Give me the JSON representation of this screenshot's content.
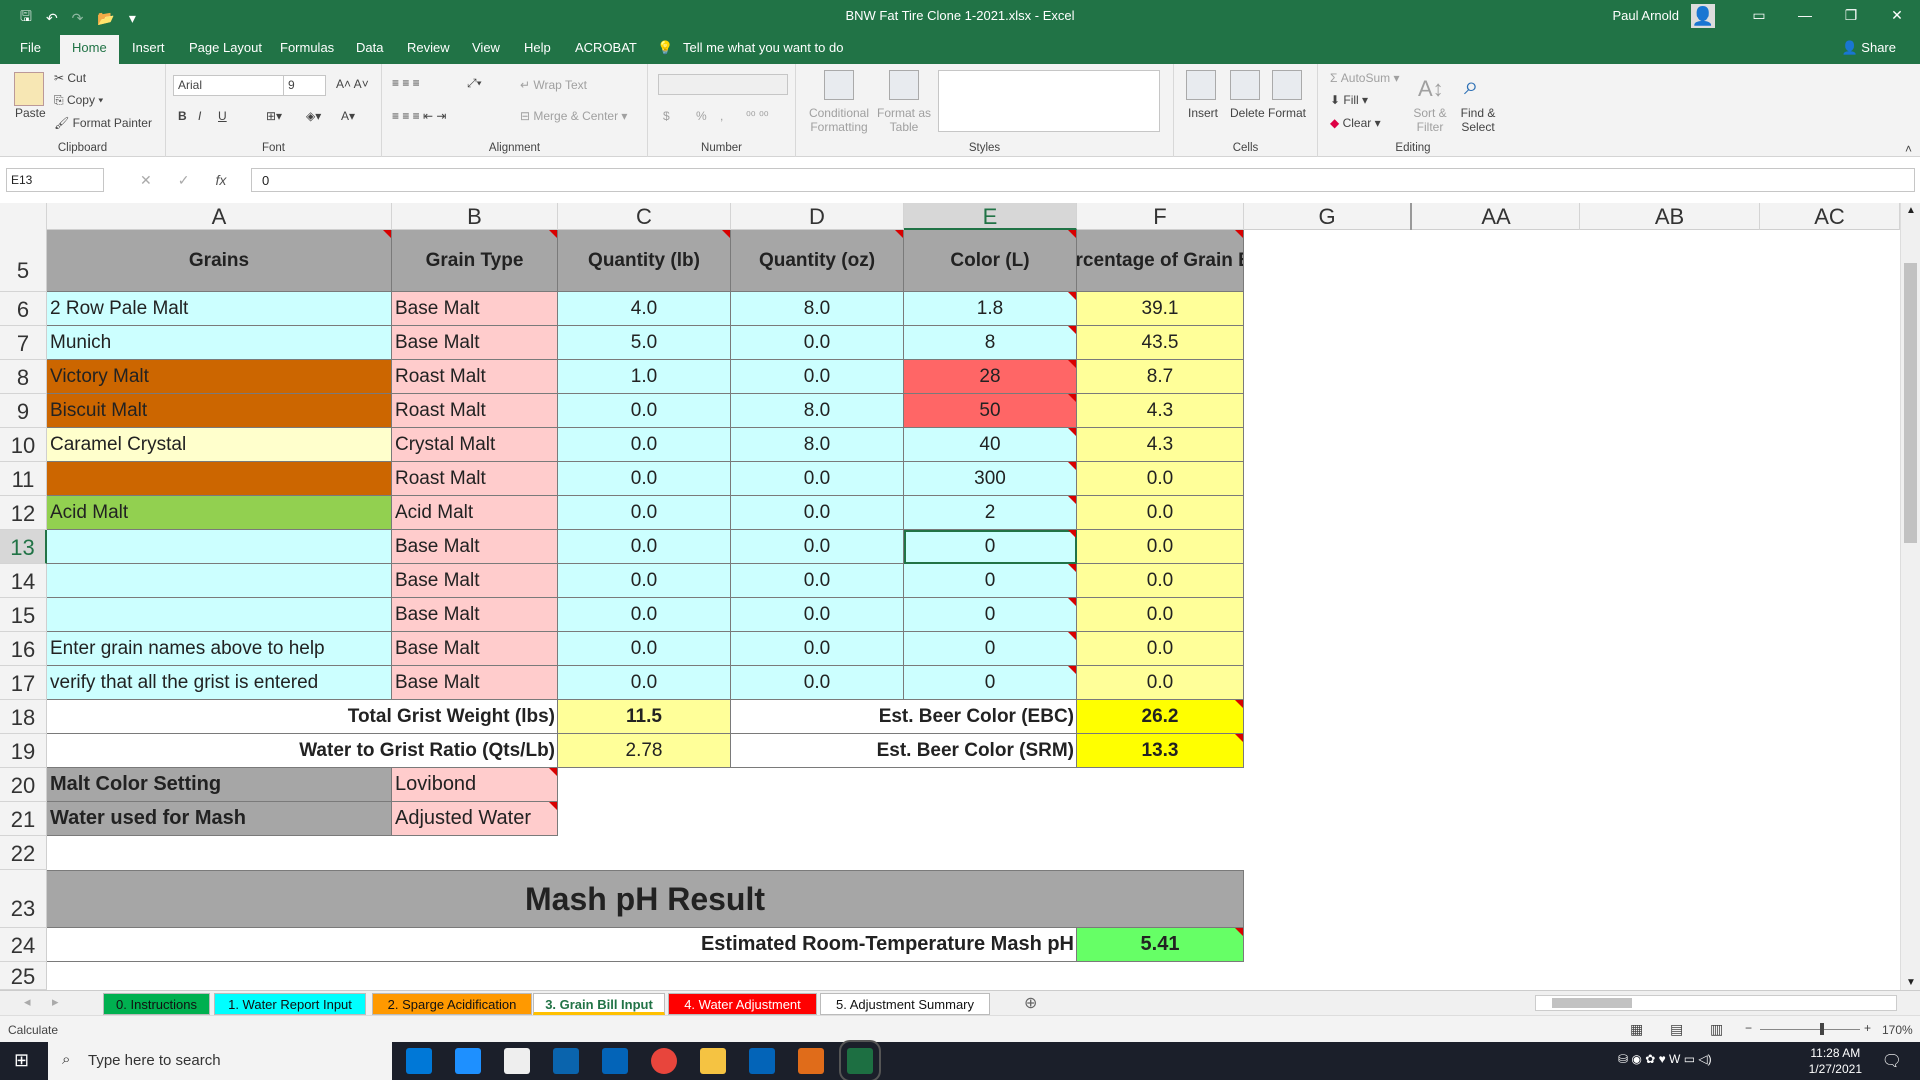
{
  "window": {
    "title": "BNW Fat Tire Clone 1-2021.xlsx  -  Excel",
    "user": "Paul Arnold"
  },
  "tabs": [
    "File",
    "Home",
    "Insert",
    "Page Layout",
    "Formulas",
    "Data",
    "Review",
    "View",
    "Help",
    "ACROBAT"
  ],
  "tell_me": "Tell me what you want to do",
  "share": "Share",
  "ribbon": {
    "clipboard": {
      "label": "Clipboard",
      "paste": "Paste",
      "cut": "Cut",
      "copy": "Copy",
      "format_painter": "Format Painter"
    },
    "font": {
      "label": "Font",
      "name": "Arial",
      "size": "9"
    },
    "alignment": {
      "label": "Alignment",
      "wrap": "Wrap Text",
      "merge": "Merge & Center"
    },
    "number": {
      "label": "Number",
      "currency": "$",
      "percent": "%",
      "comma": ","
    },
    "styles": {
      "label": "Styles",
      "conditional": "Conditional Formatting",
      "format_table": "Format as Table"
    },
    "cells": {
      "label": "Cells",
      "insert": "Insert",
      "delete": "Delete",
      "format": "Format"
    },
    "editing": {
      "label": "Editing",
      "autosum": "AutoSum",
      "fill": "Fill",
      "clear": "Clear",
      "sort": "Sort & Filter",
      "find": "Find & Select"
    }
  },
  "formula_bar": {
    "name_box": "E13",
    "value": "0"
  },
  "columns": [
    "A",
    "B",
    "C",
    "D",
    "E",
    "F",
    "G",
    "AA",
    "AB",
    "AC"
  ],
  "rows": [
    5,
    6,
    7,
    8,
    9,
    10,
    11,
    12,
    13,
    14,
    15,
    16,
    17,
    18,
    19,
    20,
    21,
    22,
    23,
    24,
    25
  ],
  "headers": {
    "grains": "Grains",
    "type": "Grain Type",
    "qty_lb": "Quantity (lb)",
    "qty_oz": "Quantity (oz)",
    "color": "Color (L)",
    "pct": "Percentage of Grain Bill"
  },
  "grain_rows": [
    {
      "name": "2 Row Pale Malt",
      "type": "Base Malt",
      "lb": "4.0",
      "oz": "8.0",
      "color": "1.8",
      "pct": "39.1"
    },
    {
      "name": "Munich",
      "type": "Base Malt",
      "lb": "5.0",
      "oz": "0.0",
      "color": "8",
      "pct": "43.5"
    },
    {
      "name": "Victory Malt",
      "type": "Roast Malt",
      "lb": "1.0",
      "oz": "0.0",
      "color": "28",
      "pct": "8.7"
    },
    {
      "name": "Biscuit Malt",
      "type": "Roast Malt",
      "lb": "0.0",
      "oz": "8.0",
      "color": "50",
      "pct": "4.3"
    },
    {
      "name": "Caramel Crystal",
      "type": "Crystal Malt",
      "lb": "0.0",
      "oz": "8.0",
      "color": "40",
      "pct": "4.3"
    },
    {
      "name": "",
      "type": "Roast Malt",
      "lb": "0.0",
      "oz": "0.0",
      "color": "300",
      "pct": "0.0"
    },
    {
      "name": "Acid Malt",
      "type": "Acid Malt",
      "lb": "0.0",
      "oz": "0.0",
      "color": "2",
      "pct": "0.0"
    },
    {
      "name": "",
      "type": "Base Malt",
      "lb": "0.0",
      "oz": "0.0",
      "color": "0",
      "pct": "0.0"
    },
    {
      "name": "",
      "type": "Base Malt",
      "lb": "0.0",
      "oz": "0.0",
      "color": "0",
      "pct": "0.0"
    },
    {
      "name": "",
      "type": "Base Malt",
      "lb": "0.0",
      "oz": "0.0",
      "color": "0",
      "pct": "0.0"
    },
    {
      "name": "Enter grain names above to help",
      "type": "Base Malt",
      "lb": "0.0",
      "oz": "0.0",
      "color": "0",
      "pct": "0.0"
    },
    {
      "name": "verify that all the grist is entered",
      "type": "Base Malt",
      "lb": "0.0",
      "oz": "0.0",
      "color": "0",
      "pct": "0.0"
    }
  ],
  "summary": {
    "total_grist_label": "Total Grist Weight (lbs)",
    "total_grist": "11.5",
    "ebc_label": "Est. Beer Color (EBC)",
    "ebc": "26.2",
    "ratio_label": "Water to Grist Ratio (Qts/Lb)",
    "ratio": "2.78",
    "srm_label": "Est. Beer Color (SRM)",
    "srm": "13.3",
    "malt_setting_label": "Malt Color Setting",
    "malt_setting": "Lovibond",
    "water_label": "Water used for Mash",
    "water": "Adjusted Water",
    "result_title": "Mash pH Result",
    "ph_label": "Estimated Room-Temperature Mash pH",
    "ph": "5.41"
  },
  "sheet_tabs": [
    "0. Instructions",
    "1. Water Report Input",
    "2. Sparge Acidification",
    "3. Grain Bill Input",
    "4. Water Adjustment",
    "5. Adjustment Summary"
  ],
  "status": {
    "mode": "Calculate",
    "zoom": "170%"
  },
  "taskbar": {
    "search": "Type here to search",
    "time": "11:28 AM",
    "date": "1/27/2021"
  },
  "colors": {
    "cyan": "#ccffff",
    "pink": "#ffcccc",
    "yellow": "#ffff99",
    "bright_yellow": "#ffff00",
    "orange": "#cc6600",
    "green": "#92d050",
    "red": "#ff6666",
    "ph_green": "#66ff66",
    "grey": "#a6a6a6",
    "excel_green": "#217346"
  }
}
